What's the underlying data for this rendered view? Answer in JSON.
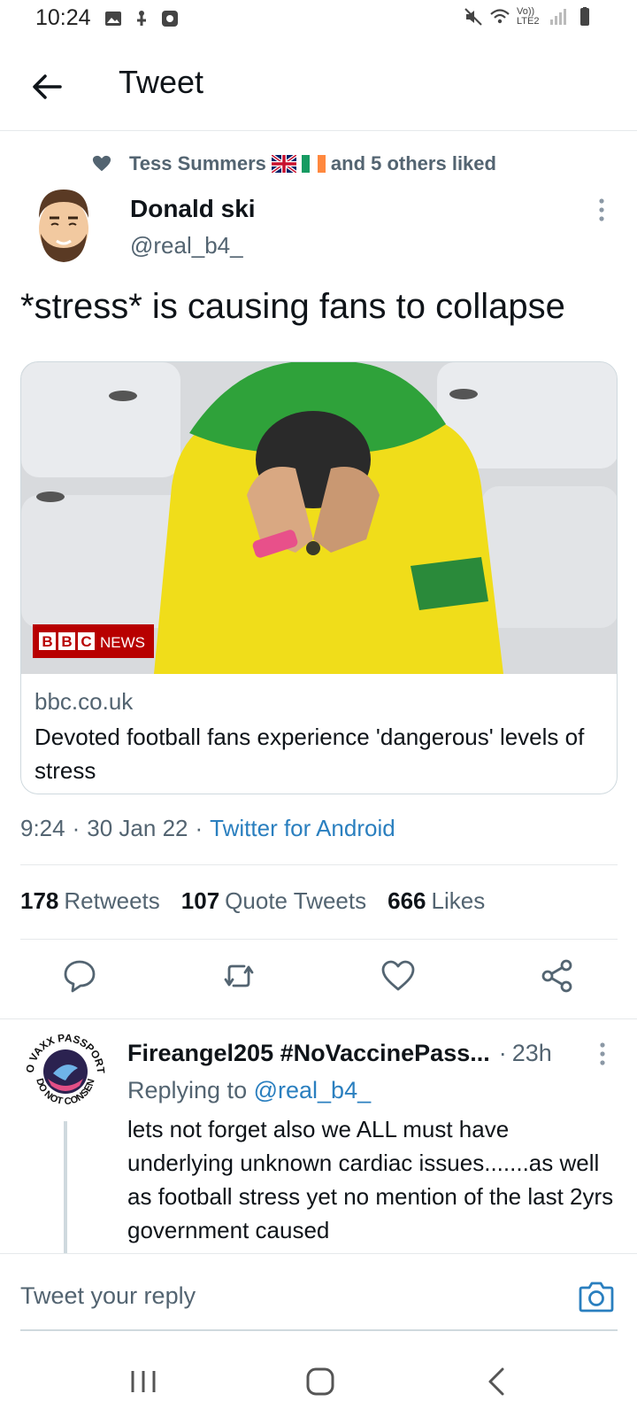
{
  "status_bar": {
    "time": "10:24",
    "left_icons": [
      "image-icon",
      "usb-icon",
      "record-icon"
    ],
    "right_icons": [
      "mute-icon",
      "wifi-icon",
      "volte-icon",
      "signal-icon",
      "battery-icon"
    ],
    "volte_label": "Vo)) LTE2"
  },
  "header": {
    "title": "Tweet",
    "back_icon": "arrow-left-icon"
  },
  "social_context": {
    "name": "Tess Summers",
    "suffix": "and 5 others liked",
    "icon": "heart-icon"
  },
  "tweet": {
    "author_name": "Donald ski",
    "author_handle": "@real_b4_",
    "text": "*stress* is causing fans to collapse",
    "card": {
      "image_badge": "BBC NEWS",
      "domain": "bbc.co.uk",
      "title": "Devoted football fans experience 'dangerous' levels of stress"
    },
    "time": "9:24",
    "date": "30 Jan 22",
    "source": "Twitter for Android",
    "stats": {
      "retweets_count": "178",
      "retweets_label": "Retweets",
      "quotes_count": "107",
      "quotes_label": "Quote Tweets",
      "likes_count": "666",
      "likes_label": "Likes"
    }
  },
  "actions": [
    "reply-icon",
    "retweet-icon",
    "like-icon",
    "share-icon"
  ],
  "reply": {
    "author_name": "Fireangel205 #NoVaccinePass...",
    "time": "23h",
    "replying_prefix": "Replying to",
    "replying_handle": "@real_b4_",
    "text": "lets not forget also we ALL must have underlying unknown cardiac issues.......as well as football stress yet no mention of the last 2yrs government caused",
    "avatar_text_top": "NO VAXX PASSPORTS",
    "avatar_text_bottom": "I DO NOT CONSENT"
  },
  "reply_bar": {
    "placeholder": "Tweet your reply"
  },
  "colors": {
    "accent": "#1d9bf0",
    "link": "#2a7fbf",
    "secondary_text": "#536471",
    "border": "#e6e9eb",
    "bbc_red": "#b80000"
  }
}
